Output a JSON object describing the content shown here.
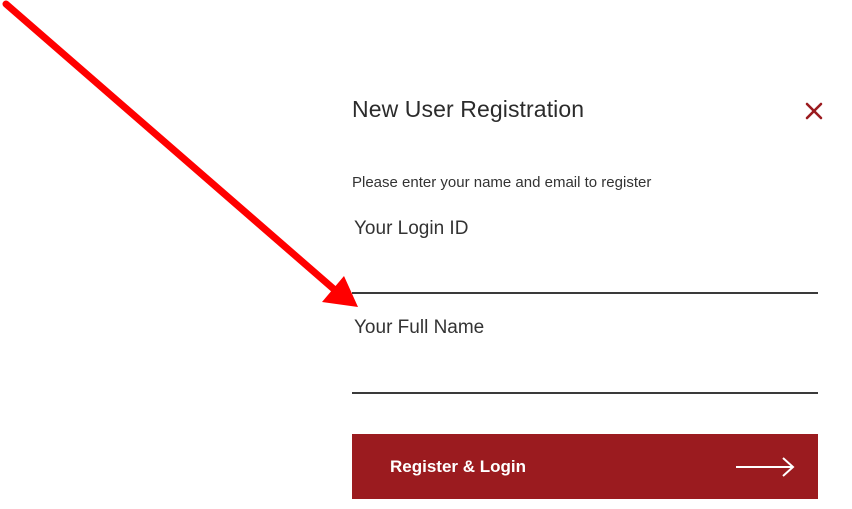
{
  "modal": {
    "title": "New User Registration",
    "subtitle": "Please enter your name and email to register",
    "close_icon": "close-icon",
    "fields": [
      {
        "label": "Your Login ID",
        "value": "",
        "placeholder": ""
      },
      {
        "label": "Your Full Name",
        "value": "",
        "placeholder": ""
      }
    ],
    "submit": {
      "label": "Register & Login",
      "icon": "arrow-right-icon"
    }
  },
  "annotation": {
    "icon": "red-pointer-arrow",
    "color": "#ff0000"
  },
  "colors": {
    "brand": "#9b1b1f",
    "text": "#2b2b2b",
    "underline": "#3a3a3a"
  }
}
